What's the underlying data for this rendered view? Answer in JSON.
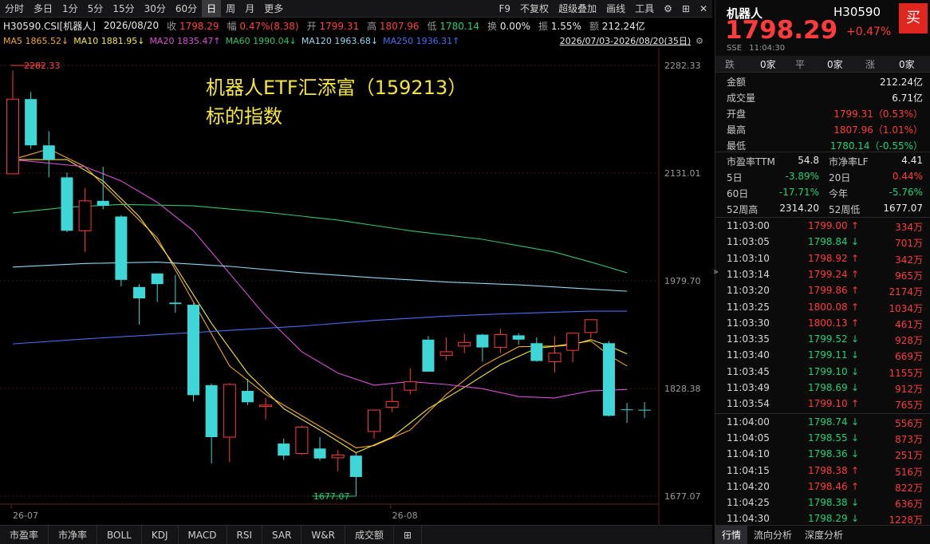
{
  "toolbar": {
    "left": [
      "分时",
      "多日",
      "1分",
      "5分",
      "15分",
      "30分",
      "60分",
      "日",
      "周",
      "月",
      "更多"
    ],
    "active_index": 7,
    "right": [
      "F9",
      "不复权",
      "超级叠加",
      "画线",
      "工具"
    ]
  },
  "info": {
    "code": "H30590.CSI[机器人]",
    "date": "2026/08/20",
    "close_label": "收",
    "close": "1798.29",
    "chg_label": "幅",
    "chg": "0.47%(8.38)",
    "open_label": "开",
    "open": "1799.31",
    "high_label": "高",
    "high": "1807.96",
    "low_label": "低",
    "low": "1780.14",
    "turnover_label": "换",
    "turnover": "0.00%",
    "amp_label": "振",
    "amp": "1.55%",
    "amount_label": "额",
    "amount": "212.24亿"
  },
  "ma": {
    "ma5": "MA5 1865.52↓",
    "ma10": "MA10 1881.95↓",
    "ma20": "MA20 1835.47↑",
    "ma60": "MA60 1990.04↓",
    "ma120": "MA120 1963.68↓",
    "ma250": "MA250 1936.31↑",
    "range": "2026/07/03-2026/08/20(35日)"
  },
  "chart_data": {
    "type": "candlestick",
    "price_axis": [
      "2282.33",
      "2131.01",
      "1979.70",
      "1828.38",
      "1677.07"
    ],
    "date_labels": [
      "26-07",
      "26-08"
    ],
    "high_marker": "2282.33",
    "low_marker": "1677.07",
    "candles": [
      {
        "o": 2130,
        "c": 2235,
        "h": 2275,
        "l": 2130
      },
      {
        "o": 2235,
        "c": 2170,
        "h": 2245,
        "l": 2165
      },
      {
        "o": 2170,
        "c": 2150,
        "h": 2190,
        "l": 2125
      },
      {
        "o": 2125,
        "c": 2050,
        "h": 2132,
        "l": 2048
      },
      {
        "o": 2050,
        "c": 2092,
        "h": 2110,
        "l": 2020
      },
      {
        "o": 2092,
        "c": 2085,
        "h": 2140,
        "l": 2080
      },
      {
        "o": 2070,
        "c": 1981,
        "h": 2072,
        "l": 1972
      },
      {
        "o": 1971,
        "c": 1955,
        "h": 1975,
        "l": 1918
      },
      {
        "o": 1990,
        "c": 1975,
        "h": 1990,
        "l": 1950
      },
      {
        "o": 1949,
        "c": 1947,
        "h": 1988,
        "l": 1935
      },
      {
        "o": 1946,
        "c": 1819,
        "h": 1948,
        "l": 1810
      },
      {
        "o": 1833,
        "c": 1760,
        "h": 1835,
        "l": 1723
      },
      {
        "o": 1760,
        "c": 1834,
        "h": 1836,
        "l": 1725
      },
      {
        "o": 1825,
        "c": 1809,
        "h": 1842,
        "l": 1805
      },
      {
        "o": 1803,
        "c": 1805,
        "h": 1815,
        "l": 1785
      },
      {
        "o": 1751,
        "c": 1734,
        "h": 1758,
        "l": 1728
      },
      {
        "o": 1737,
        "c": 1774,
        "h": 1776,
        "l": 1735
      },
      {
        "o": 1744,
        "c": 1730,
        "h": 1760,
        "l": 1727
      },
      {
        "o": 1731,
        "c": 1735,
        "h": 1742,
        "l": 1712
      },
      {
        "o": 1734,
        "c": 1704,
        "h": 1739,
        "l": 1677
      },
      {
        "o": 1768,
        "c": 1798,
        "h": 1799,
        "l": 1758
      },
      {
        "o": 1802,
        "c": 1810,
        "h": 1830,
        "l": 1795
      },
      {
        "o": 1826,
        "c": 1838,
        "h": 1857,
        "l": 1820
      },
      {
        "o": 1897,
        "c": 1852,
        "h": 1902,
        "l": 1852
      },
      {
        "o": 1875,
        "c": 1880,
        "h": 1900,
        "l": 1868
      },
      {
        "o": 1888,
        "c": 1893,
        "h": 1905,
        "l": 1878
      },
      {
        "o": 1904,
        "c": 1886,
        "h": 1905,
        "l": 1866
      },
      {
        "o": 1886,
        "c": 1904,
        "h": 1912,
        "l": 1878
      },
      {
        "o": 1903,
        "c": 1897,
        "h": 1906,
        "l": 1890
      },
      {
        "o": 1892,
        "c": 1867,
        "h": 1900,
        "l": 1866
      },
      {
        "o": 1866,
        "c": 1878,
        "h": 1902,
        "l": 1851
      },
      {
        "o": 1882,
        "c": 1906,
        "h": 1906,
        "l": 1865
      },
      {
        "o": 1907,
        "c": 1925,
        "h": 1925,
        "l": 1899
      },
      {
        "o": 1892,
        "c": 1790,
        "h": 1895,
        "l": 1789
      },
      {
        "o": 1799,
        "c": 1798,
        "h": 1808,
        "l": 1780
      }
    ],
    "ma_series": [
      {
        "name": "MA5",
        "color": "#f5a623",
        "points": [
          [
            0,
            2150
          ],
          [
            2,
            2165
          ],
          [
            4,
            2140
          ],
          [
            6,
            2090
          ],
          [
            8,
            2040
          ],
          [
            10,
            1950
          ],
          [
            12,
            1860
          ],
          [
            14,
            1820
          ],
          [
            16,
            1790
          ],
          [
            18,
            1760
          ],
          [
            19,
            1745
          ],
          [
            20,
            1748
          ],
          [
            22,
            1770
          ],
          [
            24,
            1820
          ],
          [
            26,
            1860
          ],
          [
            28,
            1887
          ],
          [
            30,
            1888
          ],
          [
            32,
            1895
          ],
          [
            33,
            1875
          ],
          [
            34,
            1860
          ]
        ]
      },
      {
        "name": "MA10",
        "color": "#f5e53c",
        "points": [
          [
            0,
            2150
          ],
          [
            3,
            2150
          ],
          [
            5,
            2120
          ],
          [
            7,
            2070
          ],
          [
            9,
            2000
          ],
          [
            11,
            1920
          ],
          [
            13,
            1850
          ],
          [
            15,
            1800
          ],
          [
            17,
            1770
          ],
          [
            19,
            1738
          ],
          [
            21,
            1760
          ],
          [
            23,
            1800
          ],
          [
            25,
            1830
          ],
          [
            27,
            1862
          ],
          [
            29,
            1885
          ],
          [
            31,
            1890
          ],
          [
            32,
            1897
          ],
          [
            33,
            1888
          ],
          [
            34,
            1877
          ]
        ]
      },
      {
        "name": "MA20",
        "color": "#d94fd9",
        "points": [
          [
            0,
            2150
          ],
          [
            4,
            2140
          ],
          [
            6,
            2120
          ],
          [
            8,
            2090
          ],
          [
            10,
            2050
          ],
          [
            12,
            1990
          ],
          [
            14,
            1930
          ],
          [
            16,
            1880
          ],
          [
            18,
            1850
          ],
          [
            20,
            1833
          ],
          [
            22,
            1838
          ],
          [
            24,
            1834
          ],
          [
            26,
            1828
          ],
          [
            28,
            1817
          ],
          [
            30,
            1815
          ],
          [
            32,
            1825
          ],
          [
            34,
            1827
          ]
        ]
      },
      {
        "name": "MA60",
        "color": "#2ec46b",
        "points": [
          [
            0,
            2075
          ],
          [
            3,
            2083
          ],
          [
            6,
            2087
          ],
          [
            10,
            2085
          ],
          [
            14,
            2076
          ],
          [
            18,
            2065
          ],
          [
            22,
            2050
          ],
          [
            26,
            2038
          ],
          [
            30,
            2020
          ],
          [
            32,
            2006
          ],
          [
            34,
            1991
          ]
        ]
      },
      {
        "name": "MA120",
        "color": "#8ed8f0",
        "points": [
          [
            0,
            1999
          ],
          [
            4,
            2004
          ],
          [
            8,
            2006
          ],
          [
            12,
            2000
          ],
          [
            16,
            1991
          ],
          [
            20,
            1984
          ],
          [
            24,
            1978
          ],
          [
            28,
            1974
          ],
          [
            32,
            1968
          ],
          [
            34,
            1965
          ]
        ]
      },
      {
        "name": "MA250",
        "color": "#4a6cf5",
        "points": [
          [
            0,
            1891
          ],
          [
            4,
            1898
          ],
          [
            8,
            1904
          ],
          [
            12,
            1910
          ],
          [
            16,
            1916
          ],
          [
            20,
            1924
          ],
          [
            24,
            1930
          ],
          [
            28,
            1934
          ],
          [
            32,
            1937
          ],
          [
            34,
            1937
          ]
        ]
      }
    ]
  },
  "note": {
    "line1": "机器人ETF汇添富（159213）",
    "line2": "标的指数"
  },
  "bottom_tabs": [
    "市盈率",
    "市净率",
    "BOLL",
    "KDJ",
    "MACD",
    "RSI",
    "SAR",
    "W&R",
    "成交额"
  ],
  "quote": {
    "name": "机器人",
    "code": "H30590",
    "buy_label": "买",
    "price": "1798.29",
    "change": "+0.47%",
    "market": "SSE",
    "time": "11:04:30",
    "counts": [
      {
        "label": "跌",
        "value": "0家"
      },
      {
        "label": "平",
        "value": "0家"
      },
      {
        "label": "涨",
        "value": "0家"
      }
    ],
    "stats": [
      {
        "label": "金额",
        "value": "212.24亿",
        "color": "white"
      },
      {
        "label": "成交量",
        "value": "6.71亿",
        "color": "white"
      },
      {
        "label": "开盘",
        "value": "1799.31（0.53%）",
        "color": "red"
      },
      {
        "label": "最高",
        "value": "1807.96（1.01%）",
        "color": "red"
      },
      {
        "label": "最低",
        "value": "1780.14（-0.55%）",
        "color": "green"
      }
    ],
    "metrics": [
      [
        {
          "label": "市盈率TTM",
          "value": "54.8",
          "color": "white"
        },
        {
          "label": "市净率LF",
          "value": "4.41",
          "color": "white"
        }
      ],
      [
        {
          "label": "5日",
          "value": "-3.89%",
          "color": "green"
        },
        {
          "label": "20日",
          "value": "0.44%",
          "color": "red"
        }
      ],
      [
        {
          "label": "60日",
          "value": "-17.71%",
          "color": "green"
        },
        {
          "label": "今年",
          "value": "-5.76%",
          "color": "green"
        }
      ],
      [
        {
          "label": "52周高",
          "value": "2314.20",
          "color": "white"
        },
        {
          "label": "52周低",
          "value": "1677.07",
          "color": "white"
        }
      ]
    ],
    "ticks": [
      {
        "time": "11:03:00",
        "price": "1799.00",
        "dir": "up",
        "vol": "334万"
      },
      {
        "time": "11:03:05",
        "price": "1798.84",
        "dir": "down",
        "vol": "701万"
      },
      {
        "time": "11:03:10",
        "price": "1798.92",
        "dir": "up",
        "vol": "342万"
      },
      {
        "time": "11:03:14",
        "price": "1799.24",
        "dir": "up",
        "vol": "965万"
      },
      {
        "time": "11:03:20",
        "price": "1799.86",
        "dir": "up",
        "vol": "2174万"
      },
      {
        "time": "11:03:25",
        "price": "1800.08",
        "dir": "up",
        "vol": "1034万"
      },
      {
        "time": "11:03:30",
        "price": "1800.13",
        "dir": "up",
        "vol": "461万"
      },
      {
        "time": "11:03:35",
        "price": "1799.52",
        "dir": "down",
        "vol": "928万"
      },
      {
        "time": "11:03:40",
        "price": "1799.11",
        "dir": "down",
        "vol": "669万"
      },
      {
        "time": "11:03:45",
        "price": "1799.10",
        "dir": "down",
        "vol": "1155万"
      },
      {
        "time": "11:03:49",
        "price": "1798.69",
        "dir": "down",
        "vol": "912万"
      },
      {
        "time": "11:03:54",
        "price": "1799.10",
        "dir": "up",
        "vol": "765万"
      },
      {
        "time": "11:04:00",
        "price": "1798.74",
        "dir": "down",
        "vol": "556万"
      },
      {
        "time": "11:04:05",
        "price": "1798.55",
        "dir": "down",
        "vol": "873万"
      },
      {
        "time": "11:04:10",
        "price": "1798.36",
        "dir": "down",
        "vol": "251万"
      },
      {
        "time": "11:04:15",
        "price": "1798.38",
        "dir": "up",
        "vol": "516万"
      },
      {
        "time": "11:04:20",
        "price": "1798.46",
        "dir": "up",
        "vol": "822万"
      },
      {
        "time": "11:04:25",
        "price": "1798.38",
        "dir": "down",
        "vol": "636万"
      },
      {
        "time": "11:04:30",
        "price": "1798.29",
        "dir": "down",
        "vol": "1228万"
      }
    ],
    "tabs": [
      "行情",
      "流向分析",
      "深度分析"
    ]
  },
  "colors": {
    "up": "#ff3b3b",
    "down": "#3ed6d6",
    "grid": "#3a1c1c",
    "axis": "#9a9a9a"
  }
}
